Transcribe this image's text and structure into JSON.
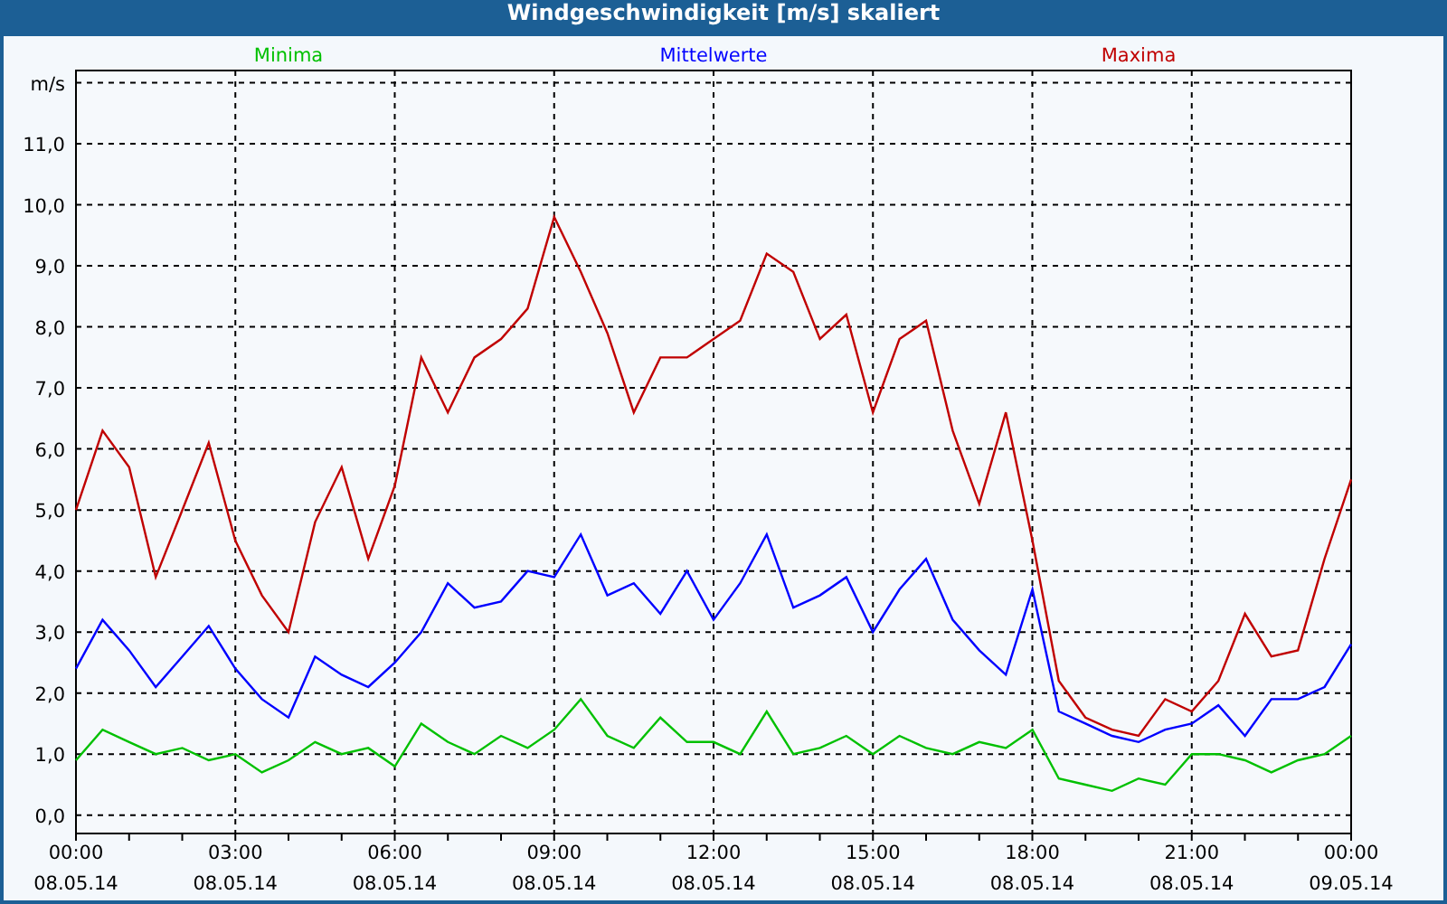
{
  "window": {
    "title": "Windgeschwindigkeit [m/s] skaliert"
  },
  "chart": {
    "chart_data": {
      "type": "line",
      "categories": [
        "00:00\n08.05.14",
        null,
        null,
        null,
        null,
        null,
        "03:00\n08.05.14",
        null,
        null,
        null,
        null,
        null,
        "06:00\n08.05.14",
        null,
        null,
        null,
        null,
        null,
        "09:00\n08.05.14",
        null,
        null,
        null,
        null,
        null,
        "12:00\n08.05.14",
        null,
        null,
        null,
        null,
        null,
        "15:00\n08.05.14",
        null,
        null,
        null,
        null,
        null,
        "18:00\n08.05.14",
        null,
        null,
        null,
        null,
        null,
        "21:00\n08.05.14",
        null,
        null,
        null,
        null,
        null,
        "00:00\n09.05.14"
      ],
      "series": [
        {
          "name": "Minima",
          "color": "#00c000",
          "values": [
            0.9,
            1.4,
            1.2,
            1.0,
            1.1,
            0.9,
            1.0,
            0.7,
            0.9,
            1.2,
            1.0,
            1.1,
            0.8,
            1.5,
            1.2,
            1.0,
            1.3,
            1.1,
            1.4,
            1.9,
            1.3,
            1.1,
            1.6,
            1.2,
            1.2,
            1.0,
            1.7,
            1.0,
            1.1,
            1.3,
            1.0,
            1.3,
            1.1,
            1.0,
            1.2,
            1.1,
            1.4,
            0.6,
            0.5,
            0.4,
            0.6,
            0.5,
            1.0,
            1.0,
            0.9,
            0.7,
            0.9,
            1.0,
            1.3
          ]
        },
        {
          "name": "Mittelwerte",
          "color": "#0000ff",
          "values": [
            2.4,
            3.2,
            2.7,
            2.1,
            2.6,
            3.1,
            2.4,
            1.9,
            1.6,
            2.6,
            2.3,
            2.1,
            2.5,
            3.0,
            3.8,
            3.4,
            3.5,
            4.0,
            3.9,
            4.6,
            3.6,
            3.8,
            3.3,
            4.0,
            3.2,
            3.8,
            4.6,
            3.4,
            3.6,
            3.9,
            3.0,
            3.7,
            4.2,
            3.2,
            2.7,
            2.3,
            3.7,
            1.7,
            1.5,
            1.3,
            1.2,
            1.4,
            1.5,
            1.8,
            1.3,
            1.9,
            1.9,
            2.1,
            2.8
          ]
        },
        {
          "name": "Maxima",
          "color": "#c00000",
          "values": [
            5.0,
            6.3,
            5.7,
            3.9,
            5.0,
            6.1,
            4.5,
            3.6,
            3.0,
            4.8,
            5.7,
            4.2,
            5.4,
            7.5,
            6.6,
            7.5,
            7.8,
            8.3,
            9.8,
            8.9,
            7.9,
            6.6,
            7.5,
            7.5,
            7.8,
            8.1,
            9.2,
            8.9,
            7.8,
            8.2,
            6.6,
            7.8,
            8.1,
            6.3,
            5.1,
            6.6,
            4.5,
            2.2,
            1.6,
            1.4,
            1.3,
            1.9,
            1.7,
            2.2,
            3.3,
            2.6,
            2.7,
            4.2,
            5.5
          ]
        }
      ],
      "grid": true,
      "ylim": [
        -0.3,
        12.2
      ],
      "yticks": [
        {
          "value": 0,
          "label": "0,0"
        },
        {
          "value": 1,
          "label": "1,0"
        },
        {
          "value": 2,
          "label": "2,0"
        },
        {
          "value": 3,
          "label": "3,0"
        },
        {
          "value": 4,
          "label": "4,0"
        },
        {
          "value": 5,
          "label": "5,0"
        },
        {
          "value": 6,
          "label": "6,0"
        },
        {
          "value": 7,
          "label": "7,0"
        },
        {
          "value": 8,
          "label": "8,0"
        },
        {
          "value": 9,
          "label": "9,0"
        },
        {
          "value": 10,
          "label": "10,0"
        },
        {
          "value": 11,
          "label": "11,0"
        },
        {
          "value": 12,
          "label": "m/s"
        }
      ]
    }
  }
}
